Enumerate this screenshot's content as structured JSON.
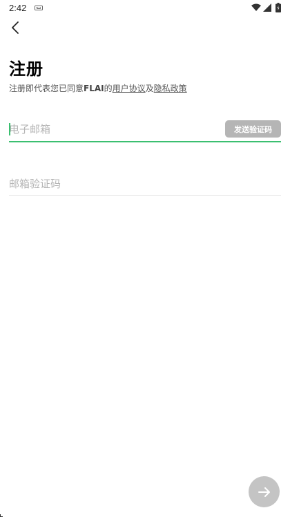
{
  "status_bar": {
    "time": "2:42",
    "icons": [
      "keyboard-icon",
      "wifi-icon",
      "signal-icon",
      "battery-icon"
    ]
  },
  "header": {
    "back_icon": "chevron-left-icon"
  },
  "page": {
    "title": "注册",
    "agreement_prefix": "注册即代表您已同意",
    "brand": "FLAI",
    "agreement_connector": "的",
    "user_agreement_link": "用户协议",
    "and_text": "及",
    "privacy_policy_link": "隐私政策"
  },
  "form": {
    "email": {
      "value": "",
      "placeholder": "电子邮箱"
    },
    "send_code_label": "发送验证码",
    "code": {
      "value": "",
      "placeholder": "邮箱验证码"
    }
  },
  "next_button": {
    "icon": "arrow-right-icon"
  },
  "colors": {
    "accent": "#3bbf70",
    "disabled_button": "#b5b5b5",
    "next_button": "#c4c4c4",
    "placeholder": "#b5b5b5"
  }
}
